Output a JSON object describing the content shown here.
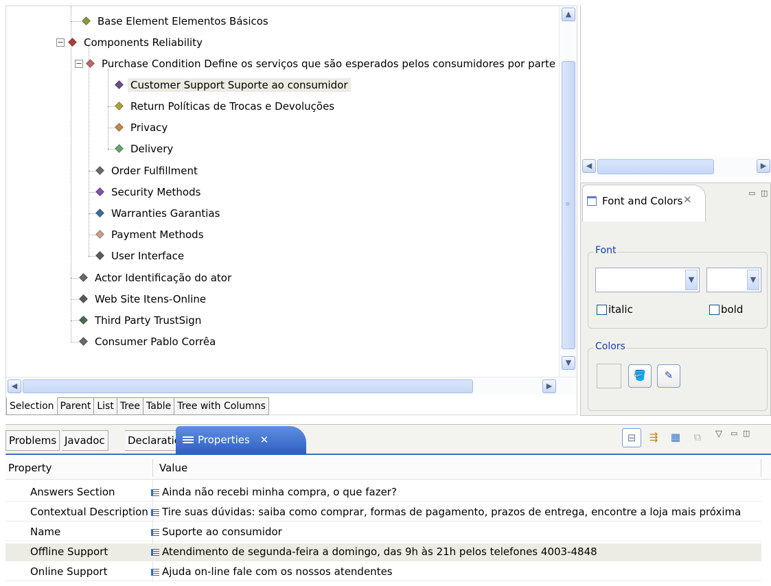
{
  "tree": {
    "items": [
      {
        "label": "Base Element Elementos Básicos",
        "color": "#8c9a3c"
      },
      {
        "label": "Components Reliability",
        "color": "#a4433a"
      },
      {
        "label": "Purchase Condition Define os serviços que são esperados pelos consumidores por parte",
        "color": "#b86c6c"
      },
      {
        "label": "Customer Support Suporte ao consumidor",
        "color": "#6f4a8f"
      },
      {
        "label": "Return Políticas de Trocas e Devoluções",
        "color": "#a8a23c"
      },
      {
        "label": "Privacy",
        "color": "#c08a4c"
      },
      {
        "label": "Delivery",
        "color": "#64a86c"
      },
      {
        "label": "Order Fulfillment",
        "color": "#6a6a6a"
      },
      {
        "label": "Security Methods",
        "color": "#7d56a8"
      },
      {
        "label": "Warranties Garantias",
        "color": "#3c6e9e"
      },
      {
        "label": "Payment Methods",
        "color": "#c8a08c"
      },
      {
        "label": "User Interface",
        "color": "#5c5c5c"
      },
      {
        "label": "Actor Identificação do ator",
        "color": "#6a6a6a"
      },
      {
        "label": "Web Site Itens-Online",
        "color": "#5a5a5a"
      },
      {
        "label": "Third Party TrustSign",
        "color": "#4e6a4e"
      },
      {
        "label": "Consumer Pablo Corrêa",
        "color": "#6a6a6a"
      }
    ],
    "tabs": [
      "Selection",
      "Parent",
      "List",
      "Tree",
      "Table",
      "Tree with Columns"
    ]
  },
  "font_colors": {
    "tab_label": "Font and Colors",
    "font_group": "Font",
    "italic_label": "italic",
    "bold_label": "bold",
    "colors_group": "Colors"
  },
  "bottom_tabs": {
    "problems": "Problems",
    "javadoc": "Javadoc",
    "declaration": "Declaration",
    "properties": "Properties"
  },
  "properties": {
    "col_property": "Property",
    "col_value": "Value",
    "rows": [
      {
        "name": "Answers Section",
        "value": "Ainda não recebi minha compra, o que fazer?"
      },
      {
        "name": "Contextual Description",
        "value": "Tire suas dúvidas: saiba como comprar, formas de pagamento, prazos de entrega, encontre a loja mais próxima"
      },
      {
        "name": "Name",
        "value": "Suporte ao consumidor"
      },
      {
        "name": "Offline Support",
        "value": "Atendimento de segunda-feira a domingo, das 9h às 21h pelos telefones 4003-4848"
      },
      {
        "name": "Online Support",
        "value": "Ajuda on-line fale com os nossos atendentes"
      }
    ]
  },
  "colors": {
    "accent_tab": "#2c5ec3",
    "selection_bg": "#ecece4",
    "group_label": "#1a3ea8"
  },
  "icons": {
    "tree_node": "diamond-icon",
    "expand": "minus-box-icon",
    "scroll_up": "chevron-up-icon",
    "scroll_down": "chevron-down-icon",
    "scroll_left": "chevron-left-icon",
    "scroll_right": "chevron-right-icon",
    "view_close": "close-icon",
    "view_tab_close": "close-x-icon",
    "properties": "properties-icon",
    "value": "text-value-icon",
    "fill_color": "paint-bucket-icon",
    "line_color": "brush-icon",
    "toolbar": [
      "categories-icon",
      "filter-advanced-icon",
      "restore-default-icon",
      "show-categories-icon"
    ]
  }
}
